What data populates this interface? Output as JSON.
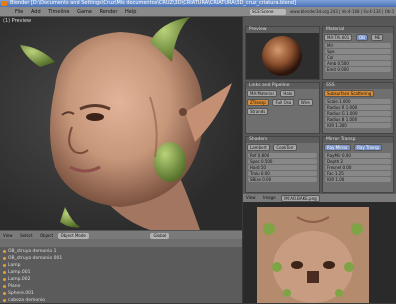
{
  "window": {
    "title": "Blender [D:\\Documents and Settings\\Cruz\\Mis documentos\\CRUZ\\3D\\CRIATURA\\CRIATURA\\3D_cruz_criatura.blend]",
    "menus": [
      "File",
      "Add",
      "Timeline",
      "Game",
      "Render",
      "Help"
    ],
    "scene": "SCE:Scene",
    "stats": "www.blender3d.org 243 | Ve:4-168 | Fa:4-134 | Ob:1-1 | La:0 | Mem:11.17M"
  },
  "viewport": {
    "label": "(1) Preview",
    "header": {
      "items": [
        "View",
        "Select",
        "Object"
      ],
      "mode": "Object Mode",
      "global": "Global"
    }
  },
  "outliner": {
    "rows": [
      "OB_struya demonio 1",
      "OB_struya demonio 001",
      "Lamp",
      "Lamp.001",
      "Lamp.002",
      "Plane",
      "Sphere.001",
      "cabeza demonio"
    ]
  },
  "preview_panel": {
    "title": "Preview"
  },
  "material_panel": {
    "title": "Material",
    "name": "MA:TAl.001",
    "links": [
      "OB",
      "ME"
    ],
    "values": [
      "Mir",
      "Spe",
      "Col",
      "Amb 0.500",
      "Emit 0.000"
    ]
  },
  "links_panel": {
    "title": "Links and Pipeline",
    "material": "MA:Material",
    "items": [
      "Halo",
      "ZTransp",
      "Full Osa",
      "Wire",
      "Strands"
    ]
  },
  "shaders_panel": {
    "title": "Shaders",
    "diffuse": "Lambert",
    "specular": "CookTorr",
    "values": [
      "Ref 0.800",
      "Spec 0.500",
      "Hard 50",
      "Tralu 0.00",
      "SBias 0.00"
    ]
  },
  "sss_panel": {
    "title": "SSS",
    "label": "Subsurface Scattering",
    "values": [
      "Scale 1.000",
      "Radius R 1.000",
      "Radius G 1.000",
      "Radius B 1.000",
      "IOR 1.300",
      "Error 0.050"
    ]
  },
  "mirror_panel": {
    "title": "Mirror Transp",
    "values": [
      "Ray Mirror",
      "RayMir 0.00",
      "Depth 2",
      "Fresnel 0.00",
      "Fac 1.25",
      "Ray Transp",
      "IOR 1.00",
      "Depth 2"
    ]
  },
  "texture_panel": {
    "tabs": [
      "Map Input",
      "Map To"
    ]
  },
  "image_editor": {
    "header": [
      "View",
      "Image"
    ],
    "image_name": "IM:AO.BAKE.png"
  },
  "colors": {
    "accent": "#e87d0d",
    "button_blue": "#7a93c7",
    "button_orange": "#d88c35",
    "skin": "#c7977a",
    "horn": "#86a64a"
  }
}
